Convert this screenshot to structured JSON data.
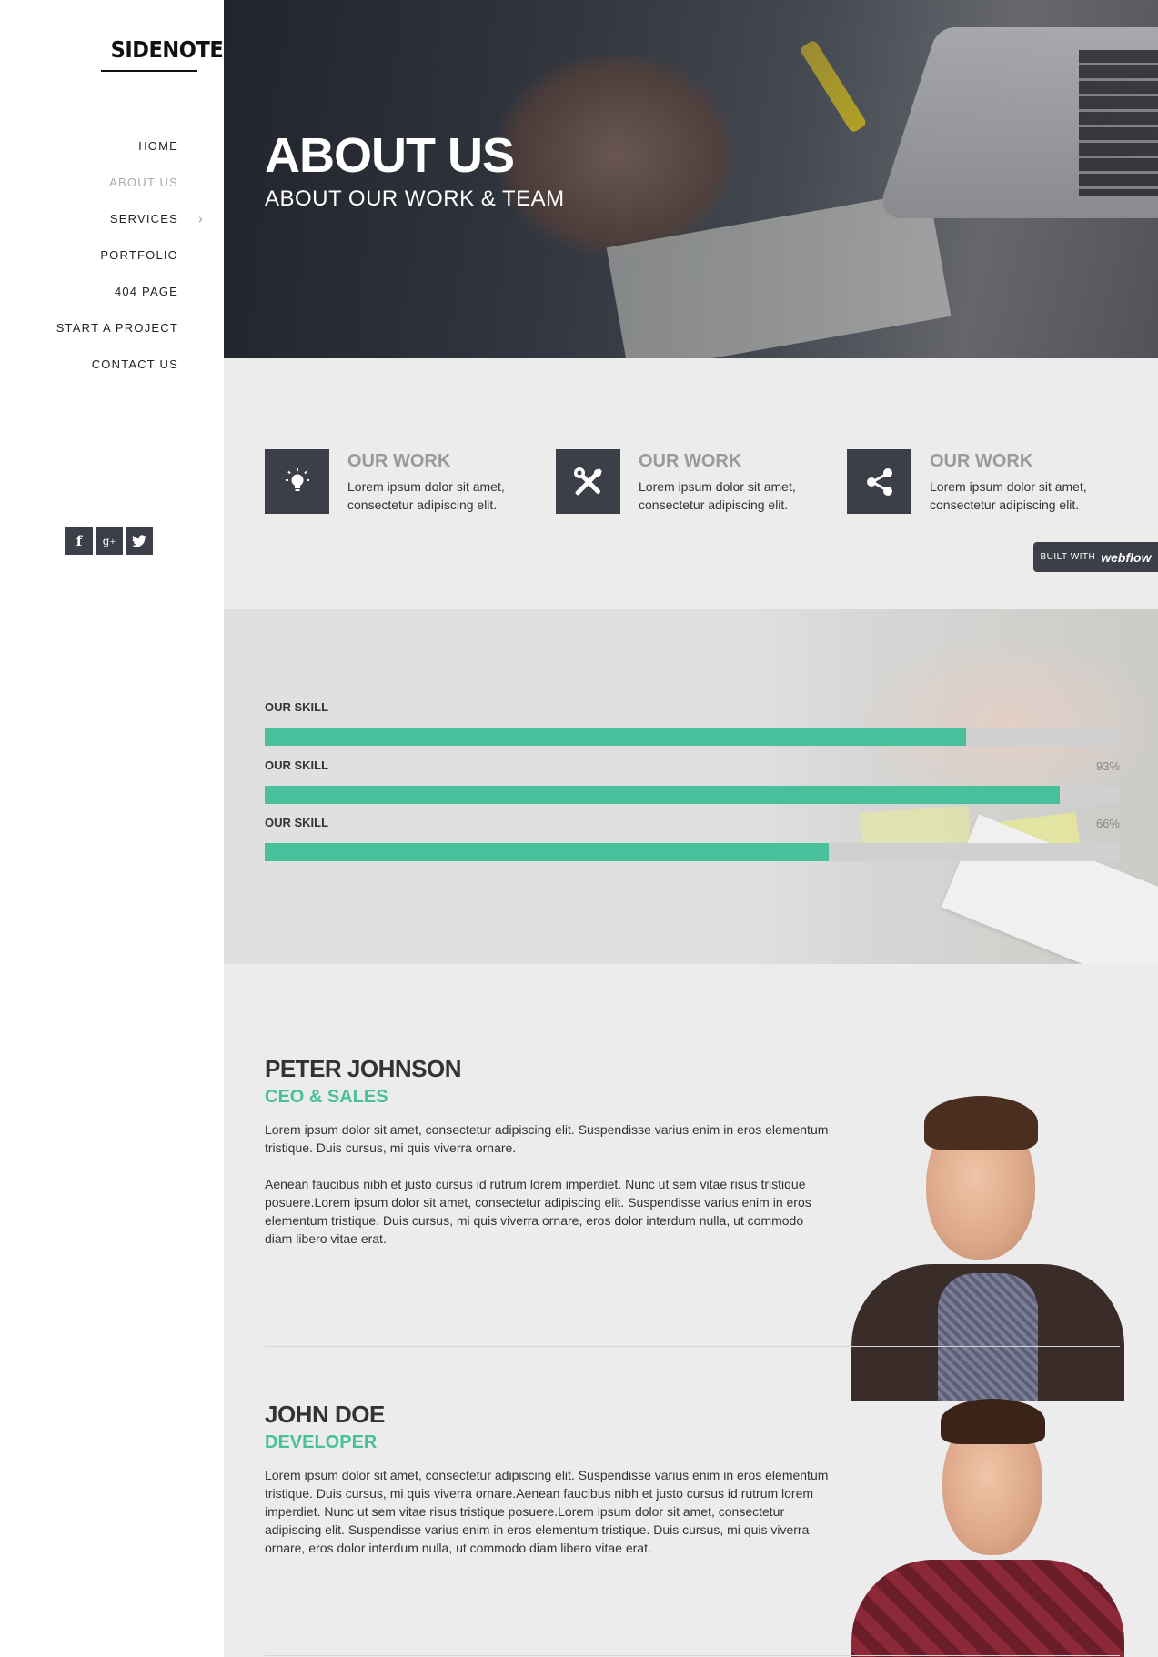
{
  "sidebar": {
    "logo": "SIDENOTE",
    "nav": [
      {
        "label": "HOME",
        "active": false
      },
      {
        "label": "ABOUT US",
        "active": true
      },
      {
        "label": "SERVICES",
        "active": false,
        "has_submenu": true
      },
      {
        "label": "PORTFOLIO",
        "active": false
      },
      {
        "label": "404 PAGE",
        "active": false
      },
      {
        "label": "START A PROJECT",
        "active": false
      },
      {
        "label": "CONTACT US",
        "active": false
      }
    ],
    "social": [
      {
        "icon": "facebook-icon",
        "glyph": "f"
      },
      {
        "icon": "google-plus-icon",
        "glyph": "g+"
      },
      {
        "icon": "twitter-icon",
        "glyph": "t"
      }
    ]
  },
  "hero": {
    "title": "ABOUT US",
    "subtitle": "ABOUT OUR WORK & TEAM"
  },
  "features": [
    {
      "icon": "lightbulb-icon",
      "title": "OUR WORK",
      "text": "Lorem ipsum dolor sit amet, consectetur adipiscing elit."
    },
    {
      "icon": "tools-icon",
      "title": "OUR WORK",
      "text": "Lorem ipsum dolor sit amet, consectetur adipiscing elit."
    },
    {
      "icon": "share-icon",
      "title": "OUR WORK",
      "text": "Lorem ipsum dolor sit amet, consectetur adipiscing elit."
    }
  ],
  "webflow_badge": {
    "prefix": "BUILT WITH",
    "brand": "webflow"
  },
  "skills": [
    {
      "label": "OUR SKILL",
      "percent_text": "",
      "value": 82
    },
    {
      "label": "OUR SKILL",
      "percent_text": "93%",
      "value": 93
    },
    {
      "label": "OUR SKILL",
      "percent_text": "66%",
      "value": 66
    }
  ],
  "colors": {
    "accent": "#47c09b",
    "dark": "#3c3f47"
  },
  "team": [
    {
      "name": "PETER JOHNSON",
      "role": "CEO & SALES",
      "bio": [
        "Lorem ipsum dolor sit amet, consectetur adipiscing elit. Suspendisse varius enim in eros elementum tristique. Duis cursus, mi quis viverra ornare.",
        "Aenean faucibus nibh et justo cursus id rutrum lorem imperdiet. Nunc ut sem vitae risus tristique posuere.Lorem ipsum dolor sit amet, consectetur adipiscing elit. Suspendisse varius enim in eros elementum tristique. Duis cursus, mi quis viverra ornare, eros dolor interdum nulla, ut commodo diam libero vitae erat."
      ]
    },
    {
      "name": "JOHN DOE",
      "role": "DEVELOPER",
      "bio": [
        "Lorem ipsum dolor sit amet, consectetur adipiscing elit. Suspendisse varius enim in eros elementum tristique. Duis cursus, mi quis viverra ornare.Aenean faucibus nibh et justo cursus id rutrum lorem imperdiet. Nunc ut sem vitae risus tristique posuere.Lorem ipsum dolor sit amet, consectetur adipiscing elit. Suspendisse varius enim in eros elementum tristique. Duis cursus, mi quis viverra ornare, eros dolor interdum nulla, ut commodo diam libero vitae erat."
      ]
    }
  ]
}
